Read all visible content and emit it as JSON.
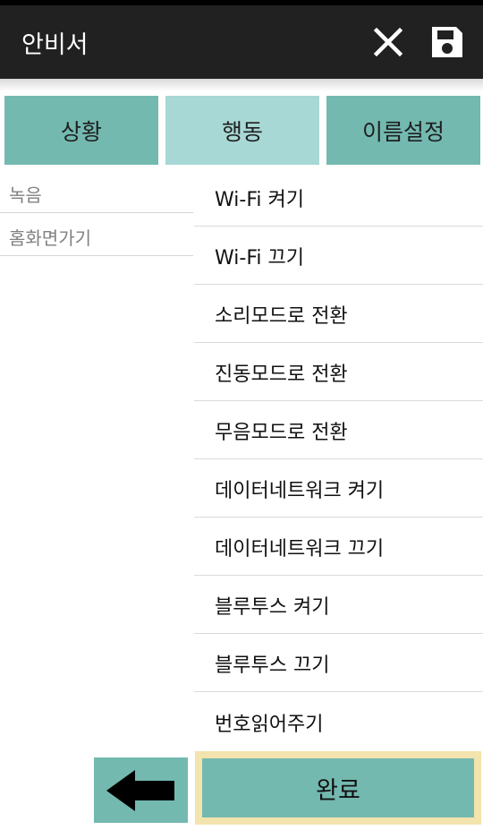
{
  "app": {
    "title": "안비서"
  },
  "toolbar": {
    "close_icon": "close-icon",
    "save_icon": "save-icon"
  },
  "tabs": [
    {
      "label": "상황"
    },
    {
      "label": "행동",
      "selected": true
    },
    {
      "label": "이름설정"
    }
  ],
  "left_list": [
    {
      "label": "녹음"
    },
    {
      "label": "홈화면가기"
    }
  ],
  "action_list": [
    {
      "label": "Wi-Fi 켜기"
    },
    {
      "label": "Wi-Fi 끄기"
    },
    {
      "label": "소리모드로 전환"
    },
    {
      "label": "진동모드로 전환"
    },
    {
      "label": "무음모드로 전환"
    },
    {
      "label": "데이터네트워크 켜기"
    },
    {
      "label": "데이터네트워크 끄기"
    },
    {
      "label": "블루투스 켜기"
    },
    {
      "label": "블루투스 끄기"
    },
    {
      "label": "번호읽어주기"
    }
  ],
  "footer": {
    "back_icon": "arrow-left-icon",
    "done_label": "완료"
  },
  "colors": {
    "appbar": "#212121",
    "tab": "#73b9b0",
    "tab_selected": "#a7d8d5",
    "done_border": "#f3e3ad"
  }
}
